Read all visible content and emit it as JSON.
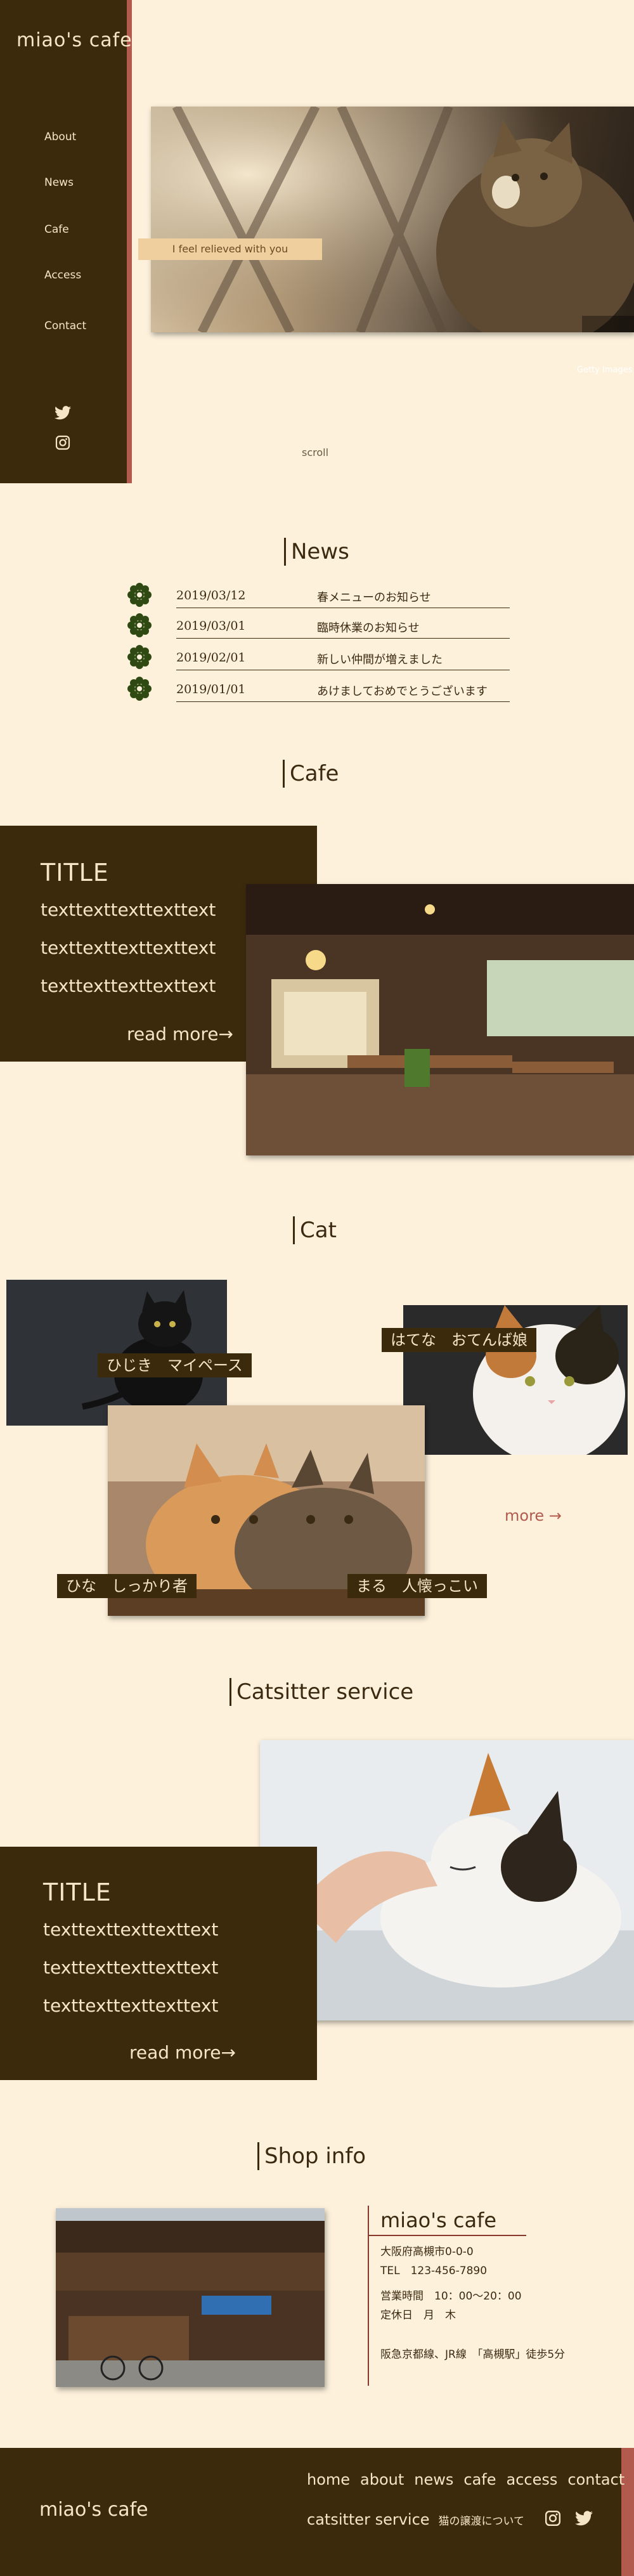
{
  "header": {
    "logo": "miao's cafe",
    "nav": [
      "About",
      "News",
      "Cafe",
      "Access",
      "Contact"
    ],
    "icons": [
      "twitter-icon",
      "instagram-icon"
    ]
  },
  "hero": {
    "tagline": "I feel relieved with you",
    "credit": "Getty Images",
    "scroll": "scroll"
  },
  "news": {
    "title": "News",
    "items": [
      {
        "date": "2019/03/12",
        "text": "春メニューのお知らせ"
      },
      {
        "date": "2019/03/01",
        "text": "臨時休業のお知らせ"
      },
      {
        "date": "2019/02/01",
        "text": "新しい仲間が増えました"
      },
      {
        "date": "2019/01/01",
        "text": "あけましておめでとうございます"
      }
    ]
  },
  "cafe": {
    "title": "Cafe",
    "box_title": "TITLE",
    "lines": [
      "texttexttexttexttext",
      "texttexttexttexttext",
      "texttexttexttexttext"
    ],
    "read_more": "read more→"
  },
  "cat": {
    "title": "Cat",
    "cats": [
      {
        "label": "ひじき　マイペース"
      },
      {
        "label": "はてな　おてんば娘"
      },
      {
        "label": "ひな　しっかり者"
      },
      {
        "label": "まる　人懐っこい"
      }
    ],
    "more": "more →"
  },
  "catsitter": {
    "title": "Catsitter service",
    "box_title": "TITLE",
    "lines": [
      "texttexttexttexttext",
      "texttexttexttexttext",
      "texttexttexttexttext"
    ],
    "read_more": "read more→"
  },
  "shop": {
    "title": "Shop info",
    "name": "miao's cafe",
    "address": "大阪府高槻市0-0-0",
    "tel": "TEL　123-456-7890",
    "hours": "営業時間　10：00〜20：00",
    "closed": "定休日　月　木",
    "access": "阪急京都線、JR線　「高槻駅」徒歩5分"
  },
  "footer": {
    "logo": "miao's cafe",
    "links": [
      "home",
      "about",
      "news",
      "cafe",
      "access",
      "contact"
    ],
    "catsitter": "catsitter service",
    "note": "猫の譲渡について"
  },
  "colors": {
    "background": "#fdf1dc",
    "brown": "#3c2a0d",
    "accent": "#b35a4e",
    "green": "#2e4a12"
  }
}
